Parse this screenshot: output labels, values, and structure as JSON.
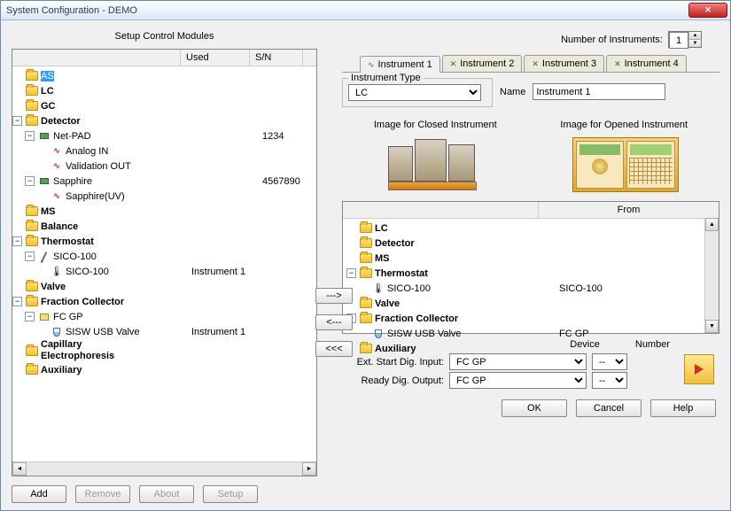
{
  "window_title": "System Configuration - DEMO",
  "left_title": "Setup Control Modules",
  "num_instruments_label": "Number of Instruments:",
  "num_instruments_value": "1",
  "tree_header": {
    "used": "Used",
    "sn": "S/N"
  },
  "tree": {
    "as": "AS",
    "lc": "LC",
    "gc": "GC",
    "detector": "Detector",
    "netpad": "Net-PAD",
    "netpad_sn": "1234",
    "analog_in": "Analog IN",
    "validation_out": "Validation OUT",
    "sapphire": "Sapphire",
    "sapphire_sn": "4567890",
    "sapphire_uv": "Sapphire(UV)",
    "ms": "MS",
    "balance": "Balance",
    "thermostat": "Thermostat",
    "sico100a": "SICO-100",
    "sico100b": "SICO-100",
    "sico100b_used": "Instrument 1",
    "valve": "Valve",
    "fraction_collector": "Fraction Collector",
    "fcgp": "FC GP",
    "sisw": "SISW USB Valve",
    "sisw_used": "Instrument 1",
    "capillary": "Capillary Electrophoresis",
    "auxiliary": "Auxiliary"
  },
  "tabs": [
    "Instrument 1",
    "Instrument 2",
    "Instrument 3",
    "Instrument 4"
  ],
  "instrument_type_legend": "Instrument Type",
  "instrument_type_value": "LC",
  "name_label": "Name",
  "name_value": "Instrument 1",
  "img_closed_label": "Image for Closed Instrument",
  "img_opened_label": "Image for Opened Instrument",
  "right_tree_header": {
    "from": "From"
  },
  "rtree": {
    "lc": "LC",
    "detector": "Detector",
    "ms": "MS",
    "thermostat": "Thermostat",
    "sico100": "SICO-100",
    "sico100_from": "SICO-100",
    "valve": "Valve",
    "fraction_collector": "Fraction Collector",
    "sisw": "SISW USB Valve",
    "sisw_from": "FC GP",
    "auxiliary": "Auxiliary"
  },
  "device_label": "Device",
  "number_label": "Number",
  "ext_start_label": "Ext. Start Dig. Input:",
  "ready_output_label": "Ready Dig. Output:",
  "device_value": "FC GP",
  "number_value": "--",
  "transfer": {
    "right": "--->",
    "left": "<---",
    "ltlt": "<<<"
  },
  "buttons": {
    "add": "Add",
    "remove": "Remove",
    "about": "About",
    "setup": "Setup",
    "ok": "OK",
    "cancel": "Cancel",
    "help": "Help"
  }
}
